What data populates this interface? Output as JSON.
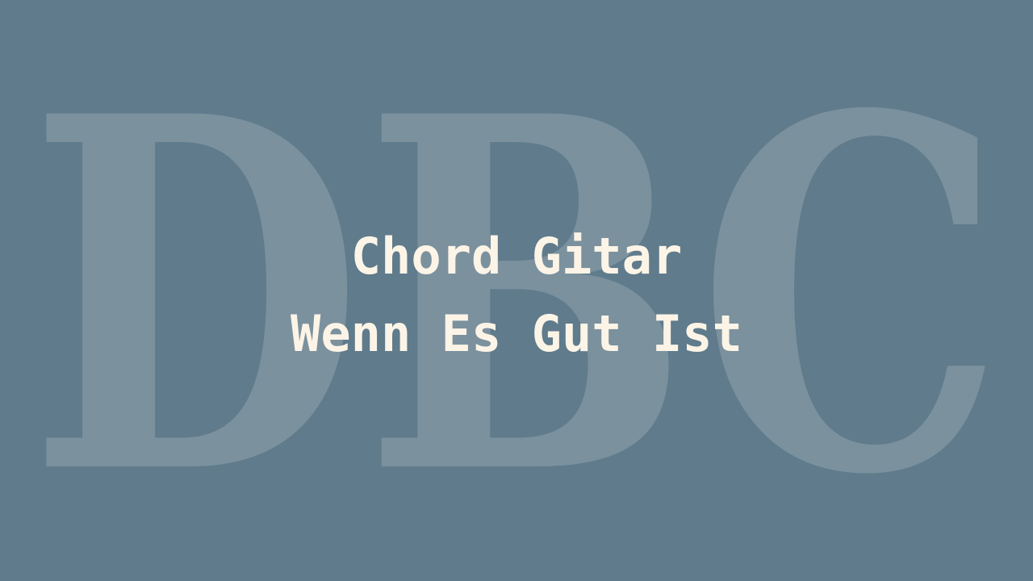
{
  "background_color": "#5f7b8c",
  "watermark": {
    "text": "DBC",
    "color": "#7b919e"
  },
  "title": {
    "line1": "Chord Gitar",
    "line2": "Wenn Es Gut Ist",
    "color": "#fcf4e6"
  }
}
